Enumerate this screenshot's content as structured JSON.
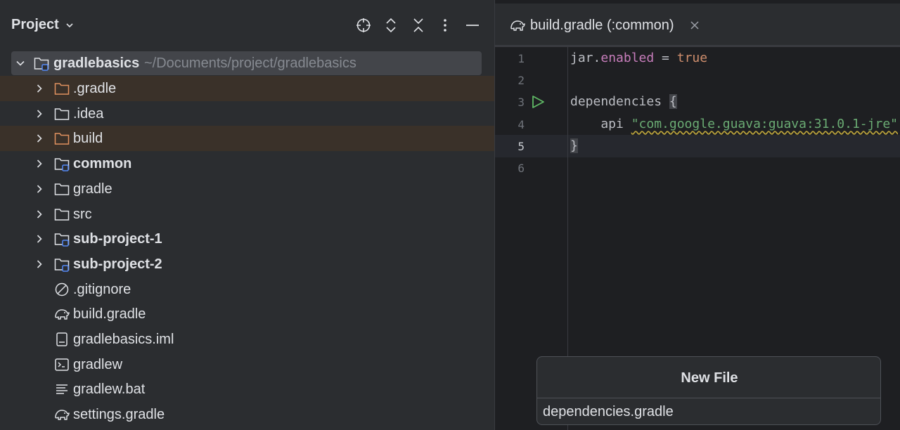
{
  "project_panel": {
    "title": "Project",
    "header_icons": [
      "locate-icon",
      "expand-collapse-icon",
      "collapse-all-icon",
      "more-options-icon",
      "minimize-icon"
    ],
    "root": {
      "name": "gradlebasics",
      "path": "~/Documents/project/gradlebasics"
    },
    "items": [
      {
        "label": ".gradle",
        "type": "folder-excluded",
        "expandable": true,
        "bold": false,
        "highlight": true
      },
      {
        "label": ".idea",
        "type": "folder",
        "expandable": true,
        "bold": false,
        "highlight": false
      },
      {
        "label": "build",
        "type": "folder-excluded",
        "expandable": true,
        "bold": false,
        "highlight": true
      },
      {
        "label": "common",
        "type": "module",
        "expandable": true,
        "bold": true,
        "highlight": false
      },
      {
        "label": "gradle",
        "type": "folder",
        "expandable": true,
        "bold": false,
        "highlight": false
      },
      {
        "label": "src",
        "type": "folder",
        "expandable": true,
        "bold": false,
        "highlight": false
      },
      {
        "label": "sub-project-1",
        "type": "module",
        "expandable": true,
        "bold": true,
        "highlight": false
      },
      {
        "label": "sub-project-2",
        "type": "module",
        "expandable": true,
        "bold": true,
        "highlight": false
      },
      {
        "label": ".gitignore",
        "type": "ignore",
        "expandable": false,
        "bold": false,
        "highlight": false
      },
      {
        "label": "build.gradle",
        "type": "gradle",
        "expandable": false,
        "bold": false,
        "highlight": false
      },
      {
        "label": "gradlebasics.iml",
        "type": "iml",
        "expandable": false,
        "bold": false,
        "highlight": false
      },
      {
        "label": "gradlew",
        "type": "shell",
        "expandable": false,
        "bold": false,
        "highlight": false
      },
      {
        "label": "gradlew.bat",
        "type": "text",
        "expandable": false,
        "bold": false,
        "highlight": false
      },
      {
        "label": "settings.gradle",
        "type": "gradle",
        "expandable": false,
        "bold": false,
        "highlight": false
      }
    ]
  },
  "editor": {
    "tab": {
      "label": "build.gradle (:common)"
    },
    "current_line": 5,
    "lines": [
      {
        "num": "1",
        "tokens": [
          [
            "plain",
            "jar."
          ],
          [
            "prop",
            "enabled"
          ],
          [
            "plain",
            " = "
          ],
          [
            "true",
            "true"
          ]
        ]
      },
      {
        "num": "2",
        "tokens": []
      },
      {
        "num": "3",
        "tokens": [
          [
            "plain",
            "dependencies "
          ],
          [
            "brace",
            "{"
          ]
        ]
      },
      {
        "num": "4",
        "tokens": [
          [
            "plain",
            "    api "
          ],
          [
            "str",
            "\"com.google.guava:guava:31.0.1-jre\""
          ]
        ]
      },
      {
        "num": "5",
        "tokens": [
          [
            "brace",
            "}"
          ]
        ]
      },
      {
        "num": "6",
        "tokens": []
      }
    ]
  },
  "new_file_popup": {
    "title": "New File",
    "value": "dependencies.gradle"
  },
  "colors": {
    "panel_bg": "#2b2d30",
    "editor_bg": "#1e1f22",
    "excluded_highlight": "#3a3129",
    "excluded_folder": "#e0915f",
    "module_dot": "#548af7",
    "run_icon": "#5fb865"
  }
}
